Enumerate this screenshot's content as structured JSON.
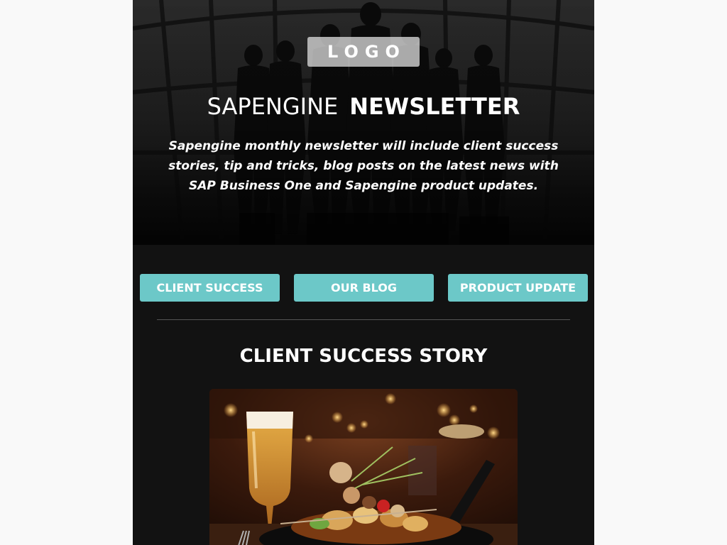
{
  "header": {
    "logo_text": "LOGO",
    "title_light": "SAPENGINE",
    "title_bold": "NEWSLETTER",
    "intro": "Sapengine monthly newsletter will include client success stories, tip and tricks, blog posts on the latest news with SAP Business One and Sapengine product updates."
  },
  "nav": {
    "client_success": "CLIENT SUCCESS",
    "our_blog": "OUR BLOG",
    "product_update": "PRODUCT UPDATE"
  },
  "section": {
    "title": "CLIENT SUCCESS STORY"
  },
  "colors": {
    "accent": "#6cc8c8",
    "background": "#121212",
    "page": "#f9f9f9"
  },
  "icons": {
    "hero_image": "business-team-silhouette-image",
    "story_image": "restaurant-dinner-photo-image"
  }
}
